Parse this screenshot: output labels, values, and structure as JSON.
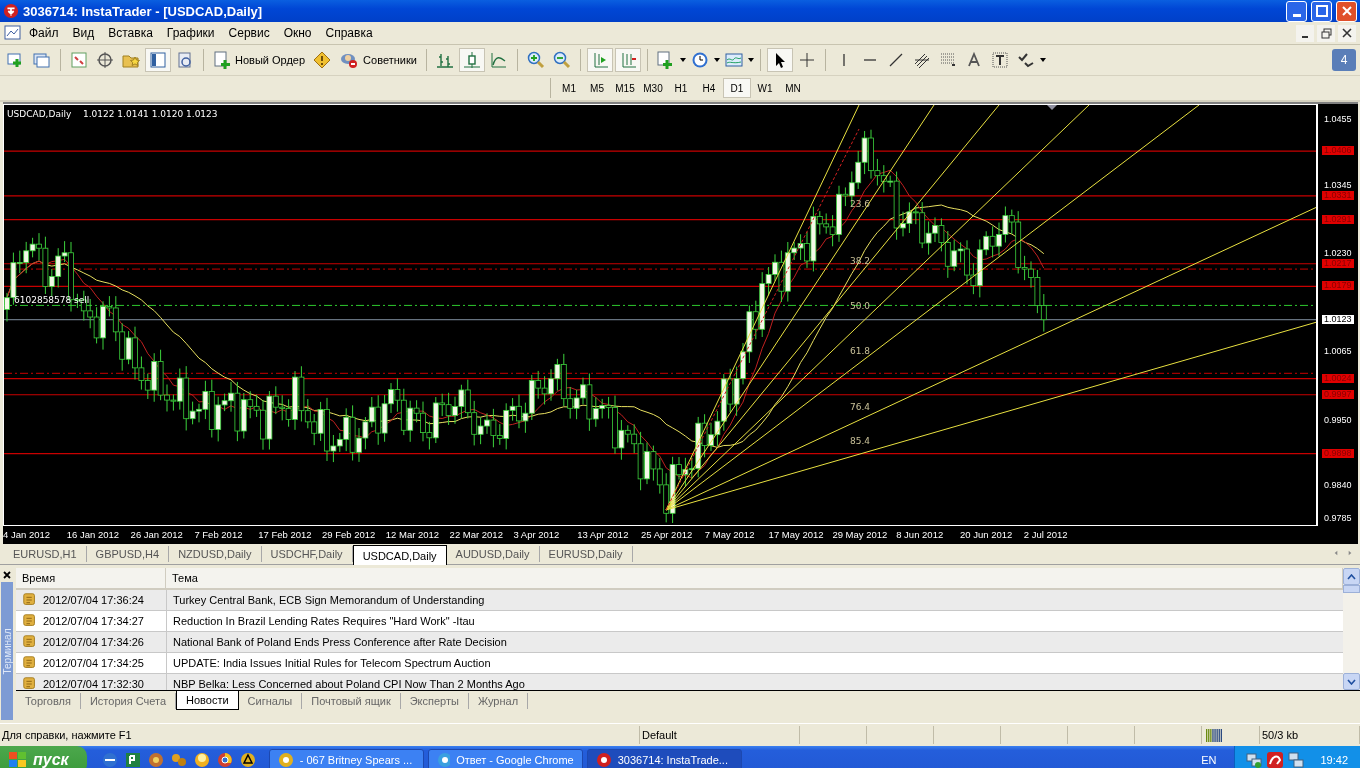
{
  "window": {
    "title": "3036714: InstaTrader - [USDCAD,Daily]"
  },
  "menu": [
    "Файл",
    "Вид",
    "Вставка",
    "Графики",
    "Сервис",
    "Окно",
    "Справка"
  ],
  "toolbar": {
    "buttons": [
      {
        "label": "Новый Ордер"
      },
      {
        "label": "Советники"
      }
    ],
    "badge": "4"
  },
  "timeframes": [
    {
      "label": "M1",
      "selected": false
    },
    {
      "label": "M5",
      "selected": false
    },
    {
      "label": "M15",
      "selected": false
    },
    {
      "label": "M30",
      "selected": false
    },
    {
      "label": "H1",
      "selected": false
    },
    {
      "label": "H4",
      "selected": false
    },
    {
      "label": "D1",
      "selected": true
    },
    {
      "label": "W1",
      "selected": false
    },
    {
      "label": "MN",
      "selected": false
    }
  ],
  "chart": {
    "symbol": "USDCAD,Daily",
    "ohlc": "1.0122 1.0141 1.0120 1.0123",
    "order_label": "6102858578 sell",
    "fib_levels": [
      "23.6",
      "38.2",
      "50.0",
      "61.8",
      "76.4",
      "85.4"
    ],
    "price_labels": [
      {
        "text": "1.0455",
        "kind": "tick"
      },
      {
        "text": "1.0406",
        "kind": "level"
      },
      {
        "text": "1.0345",
        "kind": "tick"
      },
      {
        "text": "1.0331",
        "kind": "level"
      },
      {
        "text": "1.0291",
        "kind": "level"
      },
      {
        "text": "1.0230",
        "kind": "tick"
      },
      {
        "text": "1.0217",
        "kind": "level"
      },
      {
        "text": "1.0179",
        "kind": "level"
      },
      {
        "text": "1.0123",
        "kind": "current"
      },
      {
        "text": "1.0065",
        "kind": "tick"
      },
      {
        "text": "1.0024",
        "kind": "level"
      },
      {
        "text": "0.9997",
        "kind": "level"
      },
      {
        "text": "0.9950",
        "kind": "tick"
      },
      {
        "text": "0.9898",
        "kind": "level"
      },
      {
        "text": "0.9840",
        "kind": "tick"
      },
      {
        "text": "0.9785",
        "kind": "tick"
      }
    ],
    "dates": [
      "4 Jan 2012",
      "16 Jan 2012",
      "26 Jan 2012",
      "7 Feb 2012",
      "17 Feb 2012",
      "29 Feb 2012",
      "12 Mar 2012",
      "22 Mar 2012",
      "3 Apr 2012",
      "13 Apr 2012",
      "25 Apr 2012",
      "7 May 2012",
      "17 May 2012",
      "29 May 2012",
      "8 Jun 2012",
      "20 Jun 2012",
      "2 Jul 2012"
    ]
  },
  "chart_tabs": [
    {
      "label": "EURUSD,H1",
      "selected": false
    },
    {
      "label": "GBPUSD,H4",
      "selected": false
    },
    {
      "label": "NZDUSD,Daily",
      "selected": false
    },
    {
      "label": "USDCHF,Daily",
      "selected": false
    },
    {
      "label": "USDCAD,Daily",
      "selected": true
    },
    {
      "label": "AUDUSD,Daily",
      "selected": false
    },
    {
      "label": "EURUSD,Daily",
      "selected": false
    }
  ],
  "terminal": {
    "side_label": "Терминал",
    "columns": [
      "Время",
      "Тема"
    ],
    "rows": [
      {
        "time": "2012/07/04 17:36:24",
        "subject": "Turkey Central Bank, ECB Sign Memorandum of Understanding"
      },
      {
        "time": "2012/07/04 17:34:27",
        "subject": "Reduction In Brazil Lending Rates Requires \"Hard Work\" -Itau"
      },
      {
        "time": "2012/07/04 17:34:26",
        "subject": "National Bank of Poland Ends Press Conference after Rate Decision"
      },
      {
        "time": "2012/07/04 17:34:25",
        "subject": "UPDATE: India Issues Initial Rules for Telecom Spectrum Auction"
      },
      {
        "time": "2012/07/04 17:32:30",
        "subject": "NBP Belka: Less Concerned about Poland CPI Now Than 2 Months Ago"
      }
    ],
    "tabs": [
      {
        "label": "Торговля",
        "selected": false
      },
      {
        "label": "История Счета",
        "selected": false
      },
      {
        "label": "Новости",
        "selected": true
      },
      {
        "label": "Сигналы",
        "selected": false
      },
      {
        "label": "Почтовый ящик",
        "selected": false
      },
      {
        "label": "Эксперты",
        "selected": false
      },
      {
        "label": "Журнал",
        "selected": false
      }
    ]
  },
  "status_bar": {
    "help": "Для справки, нажмите F1",
    "profile": "Default",
    "traffic": "50/3 kb"
  },
  "taskbar": {
    "start": "пуск",
    "tasks": [
      {
        "label": "- 067 Britney Spears ...",
        "selected": false
      },
      {
        "label": "Ответ - Google Chrome",
        "selected": false
      },
      {
        "label": "3036714: InstaTrade...",
        "selected": true
      }
    ],
    "language": "EN",
    "clock": "19:42"
  }
}
